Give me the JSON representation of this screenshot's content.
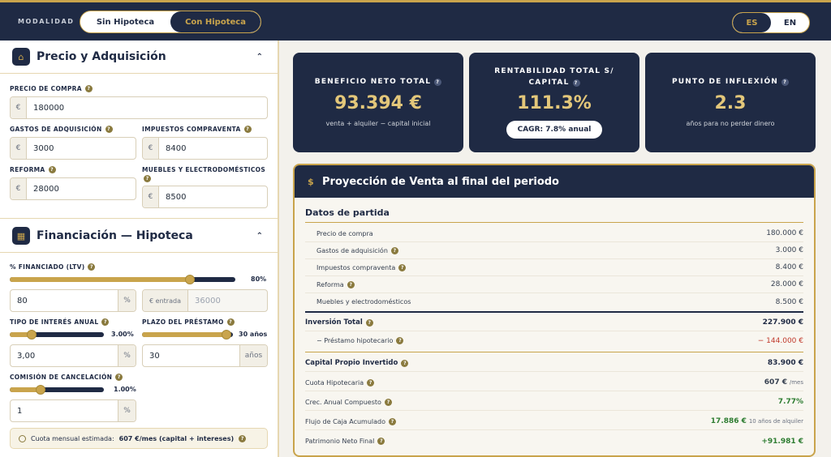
{
  "topbar": {
    "modalidad_label": "MODALIDAD",
    "mode_options": [
      "Sin Hipoteca",
      "Con Hipoteca"
    ],
    "mode_selected": "Con Hipoteca",
    "languages": [
      "ES",
      "EN"
    ],
    "language_selected": "ES"
  },
  "precio": {
    "title": "Precio y Adquisición",
    "precio_compra_label": "PRECIO DE COMPRA",
    "precio_compra_value": "180000",
    "gastos_label": "GASTOS DE ADQUISICIÓN",
    "gastos_value": "3000",
    "impuestos_label": "IMPUESTOS COMPRAVENTA",
    "impuestos_value": "8400",
    "reforma_label": "REFORMA",
    "reforma_value": "28000",
    "muebles_label": "MUEBLES Y ELECTRODOMÉSTICOS",
    "muebles_value": "8500",
    "currency": "€"
  },
  "financiacion": {
    "title": "Financiación — Hipoteca",
    "ltv_label": "% FINANCIADO (LTV)",
    "ltv_display": "80%",
    "ltv_fraction": 0.8,
    "ltv_value": "80",
    "pct": "%",
    "entrada_label": "€ entrada",
    "entrada_placeholder": "36000",
    "interes_label": "TIPO DE INTERÉS ANUAL",
    "interes_display": "3.00%",
    "interes_fraction": 0.23,
    "interes_value": "3,00",
    "plazo_label": "PLAZO DEL PRÉSTAMO",
    "plazo_display": "30 años",
    "plazo_fraction": 0.93,
    "plazo_value": "30",
    "plazo_unit": "años",
    "comision_label": "COMISIÓN DE CANCELACIÓN",
    "comision_display": "1.00%",
    "comision_fraction": 0.33,
    "comision_value": "1",
    "cuota_note_prefix": "Cuota mensual estimada:",
    "cuota_note_value": "607 €/mes (capital + intereses)"
  },
  "kpis": [
    {
      "title": "BENEFICIO NETO TOTAL",
      "value": "93.394 €",
      "sub": "venta + alquiler − capital inicial"
    },
    {
      "title_line1": "RENTABILIDAD TOTAL S/",
      "title_line2": "CAPITAL",
      "value": "111.3%",
      "badge": "CAGR: 7.8% anual"
    },
    {
      "title": "PUNTO DE INFLEXIÓN",
      "value": "2.3",
      "sub": "años para no perder dinero"
    }
  ],
  "proyeccion": {
    "title": "Proyección de Venta al final del periodo",
    "datos_title": "Datos de partida",
    "rows": [
      {
        "label": "Precio de compra",
        "value": "180.000 €"
      },
      {
        "label": "Gastos de adquisición",
        "value": "3.000 €"
      },
      {
        "label": "Impuestos compraventa",
        "value": "8.400 €"
      },
      {
        "label": "Reforma",
        "value": "28.000 €"
      },
      {
        "label": "Muebles y electrodomésticos",
        "value": "8.500 €"
      }
    ],
    "inversion_label": "Inversión Total",
    "inversion_value": "227.900 €",
    "prestamo_label": "− Préstamo hipotecario",
    "prestamo_value": "− 144.000 €",
    "capital_label": "Capital Propio Invertido",
    "capital_value": "83.900 €",
    "cuota_label": "Cuota Hipotecaria",
    "cuota_value": "607 €",
    "cuota_unit": "/mes",
    "crec_label": "Crec. Anual Compuesto",
    "crec_value": "7.77%",
    "flujo_label": "Flujo de Caja Acumulado",
    "flujo_value": "17.886 €",
    "flujo_note": "10 años de alquiler",
    "patrimonio_label": "Patrimonio Neto Final",
    "patrimonio_value": "+91.981 €"
  },
  "icons": {
    "help": "?",
    "home": "⌂",
    "calendar": "▦",
    "chevron_up": "⌃",
    "dollar": "$"
  }
}
